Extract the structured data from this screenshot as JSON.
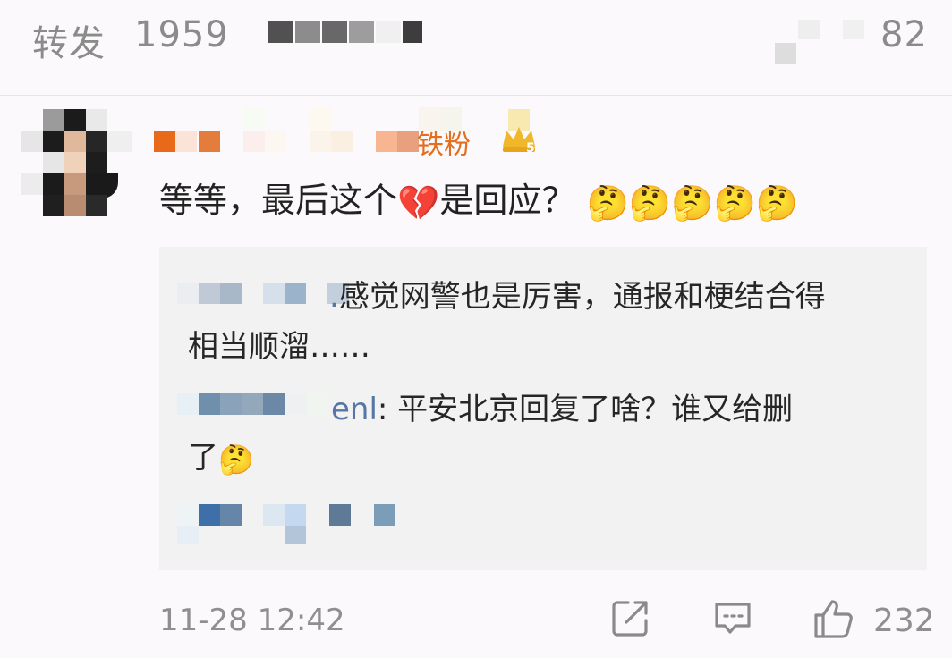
{
  "header": {
    "left_tab_label": "转发",
    "left_tab_count": "1959",
    "right_count": "82"
  },
  "comment": {
    "badge_text": "铁粉",
    "text_before_emoji": "等等，最后这个",
    "broken_heart_emoji": "💔",
    "text_after_emoji": "是回应？",
    "trailing_emoji": [
      "🤔",
      "🤔",
      "🤔",
      "🤔",
      "🤔"
    ]
  },
  "replies": [
    {
      "name_tail": ".",
      "line1": "感觉网警也是厉害，通报和梗结合得",
      "line2": "相当顺溜……"
    },
    {
      "name_tail": "enl",
      "line1": ": 平安北京回复了啥？谁又给删",
      "line2": "了",
      "emoji": "🤔"
    }
  ],
  "footer": {
    "timestamp": "11-28 12:42",
    "like_count": "232"
  },
  "icons": {
    "share": "share-icon",
    "comment": "comment-icon",
    "like": "thumbs-up-icon",
    "badge": "crown-badge-icon"
  },
  "colors": {
    "accent_orange": "#e36e1d",
    "link_blue": "#5677a6",
    "muted_gray": "#8f8f8f",
    "reply_bg": "#f2f2f2"
  }
}
